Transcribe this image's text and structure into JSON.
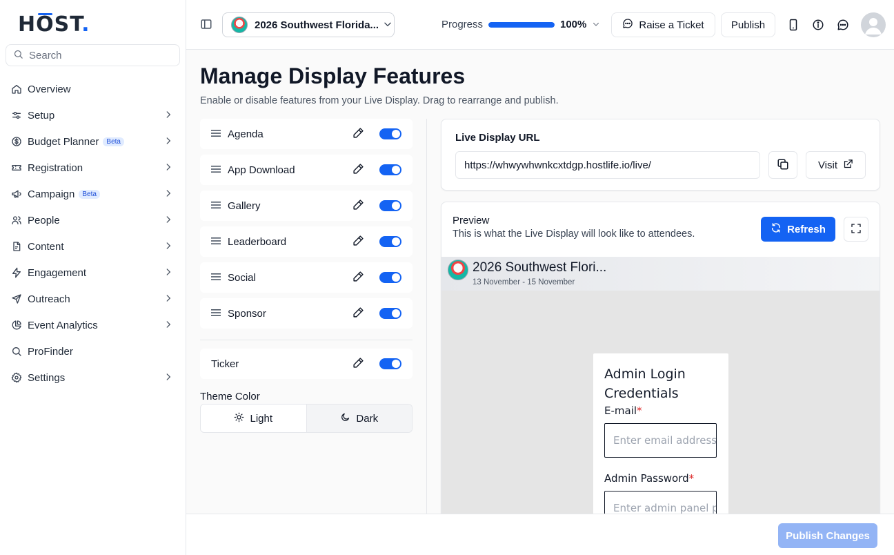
{
  "brand": {
    "logo_text": "HOST",
    "accent": "#1463f3"
  },
  "search": {
    "placeholder": "Search"
  },
  "sidebar": {
    "items": [
      {
        "label": "Overview",
        "icon": "home-icon",
        "chevron": false,
        "badge": ""
      },
      {
        "label": "Setup",
        "icon": "sliders-icon",
        "chevron": true,
        "badge": ""
      },
      {
        "label": "Budget Planner",
        "icon": "dollar-circle-icon",
        "chevron": true,
        "badge": "Beta"
      },
      {
        "label": "Registration",
        "icon": "ticket-icon",
        "chevron": true,
        "badge": ""
      },
      {
        "label": "Campaign",
        "icon": "megaphone-icon",
        "chevron": true,
        "badge": "Beta"
      },
      {
        "label": "People",
        "icon": "users-icon",
        "chevron": true,
        "badge": ""
      },
      {
        "label": "Content",
        "icon": "document-icon",
        "chevron": true,
        "badge": ""
      },
      {
        "label": "Engagement",
        "icon": "lightning-icon",
        "chevron": true,
        "badge": ""
      },
      {
        "label": "Outreach",
        "icon": "send-icon",
        "chevron": true,
        "badge": ""
      },
      {
        "label": "Event Analytics",
        "icon": "pie-chart-icon",
        "chevron": true,
        "badge": ""
      },
      {
        "label": "ProFinder",
        "icon": "search-icon",
        "chevron": false,
        "badge": ""
      },
      {
        "label": "Settings",
        "icon": "gear-icon",
        "chevron": true,
        "badge": ""
      }
    ]
  },
  "topbar": {
    "event_name": "2026 Southwest Florida...",
    "progress_label": "Progress",
    "progress_value": "100%",
    "progress_fraction": 1.0,
    "raise_ticket_label": "Raise a Ticket",
    "publish_label": "Publish"
  },
  "page": {
    "title": "Manage Display Features",
    "subtitle": "Enable or disable features from your Live Display. Drag to rearrange and publish."
  },
  "features": [
    {
      "name": "Agenda",
      "enabled": true
    },
    {
      "name": "App Download",
      "enabled": true
    },
    {
      "name": "Gallery",
      "enabled": true
    },
    {
      "name": "Leaderboard",
      "enabled": true
    },
    {
      "name": "Social",
      "enabled": true
    },
    {
      "name": "Sponsor",
      "enabled": true
    }
  ],
  "ticker": {
    "name": "Ticker",
    "enabled": true
  },
  "theme": {
    "label": "Theme Color",
    "light": "Light",
    "dark": "Dark",
    "selected": "Dark"
  },
  "live_url": {
    "title": "Live Display URL",
    "value": "https://whwywhwnkcxtdgp.hostlife.io/live/",
    "visit_label": "Visit"
  },
  "preview": {
    "title": "Preview",
    "subtitle": "This is what the Live Display will look like to attendees.",
    "refresh_label": "Refresh",
    "event_name": "2026 Southwest Flori...",
    "dates": "13 November - 15 November",
    "login": {
      "title": "Admin Login Credentials",
      "email_label": "E-mail",
      "email_placeholder": "Enter email address",
      "password_label": "Admin Password",
      "password_placeholder": "Enter admin panel password",
      "required_mark": "*"
    }
  },
  "footer": {
    "publish_changes_label": "Publish Changes"
  }
}
